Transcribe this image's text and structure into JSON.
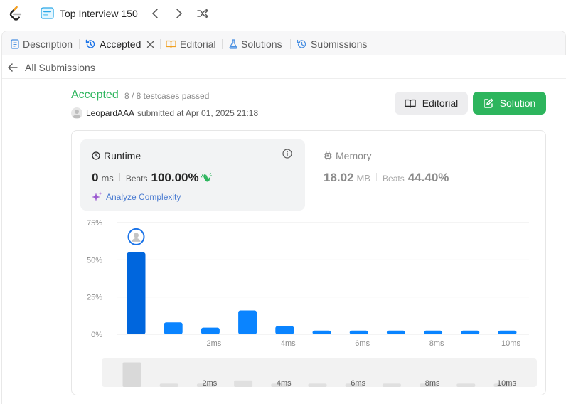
{
  "topbar": {
    "title": "Top Interview 150",
    "logo_icon": "leetcode-logo",
    "list_icon": "study-plan-icon"
  },
  "tabs": [
    {
      "label": "Description",
      "icon": "description-icon"
    },
    {
      "label": "Accepted",
      "icon": "history-icon"
    },
    {
      "label": "Editorial",
      "icon": "book-icon"
    },
    {
      "label": "Solutions",
      "icon": "flask-icon"
    },
    {
      "label": "Submissions",
      "icon": "history-icon"
    }
  ],
  "back": {
    "label": "All Submissions"
  },
  "submission": {
    "status": "Accepted",
    "testcases": "8 / 8 testcases passed",
    "user": "LeopardAAA",
    "submitted": "submitted at Apr 01, 2025 21:18"
  },
  "buttons": {
    "editorial": "Editorial",
    "solution": "Solution"
  },
  "runtime": {
    "title": "Runtime",
    "value": "0",
    "unit": "ms",
    "beats_label": "Beats",
    "beats": "100.00%",
    "analyze": "Analyze Complexity"
  },
  "memory": {
    "title": "Memory",
    "value": "18.02",
    "unit": "MB",
    "beats_label": "Beats",
    "beats": "44.40%"
  },
  "colors": {
    "accent_green": "#2db55d",
    "bar_blue": "#0a84ff",
    "bar_blue_dark": "#0066dd",
    "link_blue": "#4a7bd1",
    "purple": "#9b59d0"
  },
  "chart_data": {
    "type": "bar",
    "x": [
      0,
      1,
      2,
      3,
      4,
      5,
      6,
      7,
      8,
      9,
      10
    ],
    "xtick_labels": [
      "2ms",
      "4ms",
      "6ms",
      "8ms",
      "10ms"
    ],
    "xtick_positions": [
      2,
      4,
      6,
      8,
      10
    ],
    "values": [
      55,
      8,
      4.5,
      16,
      5.5,
      2.5,
      2.5,
      2.5,
      2.5,
      2.5,
      2.5
    ],
    "highlight_index": 0,
    "yticks": [
      "75%",
      "50%",
      "25%",
      "0%"
    ],
    "ylim": [
      0,
      75
    ],
    "grid": true,
    "minimap_values": [
      30,
      4,
      4,
      8,
      4,
      4,
      4,
      4,
      4,
      4,
      4
    ]
  }
}
